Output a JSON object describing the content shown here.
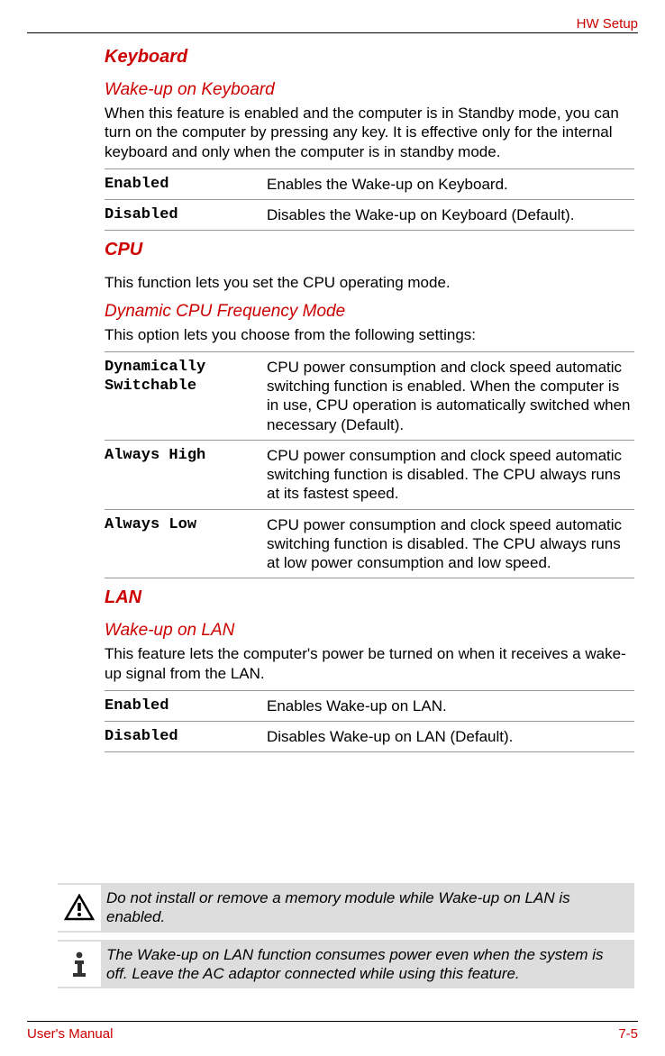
{
  "header": {
    "section": "HW Setup"
  },
  "keyboard": {
    "heading": "Keyboard",
    "sub": "Wake-up on Keyboard",
    "desc": "When this feature is enabled and the computer is in Standby mode, you can turn on the computer by pressing any key. It is effective only for the internal keyboard and only when the computer is in standby mode.",
    "rows": [
      {
        "label": "Enabled",
        "desc": "Enables the Wake-up on Keyboard."
      },
      {
        "label": "Disabled",
        "desc": "Disables the Wake-up on Keyboard (Default)."
      }
    ]
  },
  "cpu": {
    "heading": "CPU",
    "desc": "This function lets you set the CPU operating mode.",
    "sub": "Dynamic CPU Frequency Mode",
    "sub_desc": "This option lets you choose from the following settings:",
    "rows": [
      {
        "label": "Dynamically Switchable",
        "desc": "CPU power consumption and clock speed automatic switching function is enabled. When the computer is in use, CPU operation is automatically switched when necessary (Default)."
      },
      {
        "label": "Always High",
        "desc": "CPU power consumption and clock speed automatic switching function is disabled. The CPU always runs at its fastest speed."
      },
      {
        "label": "Always Low",
        "desc": "CPU power consumption and clock speed automatic switching function is disabled. The CPU always runs at low power consumption and low speed."
      }
    ]
  },
  "lan": {
    "heading": "LAN",
    "sub": "Wake-up on LAN",
    "desc": "This feature lets the computer's power be turned on when it receives a wake-up signal from the LAN.",
    "rows": [
      {
        "label": "Enabled",
        "desc": "Enables Wake-up on LAN."
      },
      {
        "label": "Disabled",
        "desc": "Disables Wake-up on LAN (Default)."
      }
    ]
  },
  "warning_note": "Do not install or remove a memory module while Wake-up on LAN is enabled.",
  "info_note": "The Wake-up on LAN function consumes power even when the system is off. Leave the AC adaptor connected while using this feature.",
  "footer": {
    "left": "User's Manual",
    "right": "7-5"
  }
}
